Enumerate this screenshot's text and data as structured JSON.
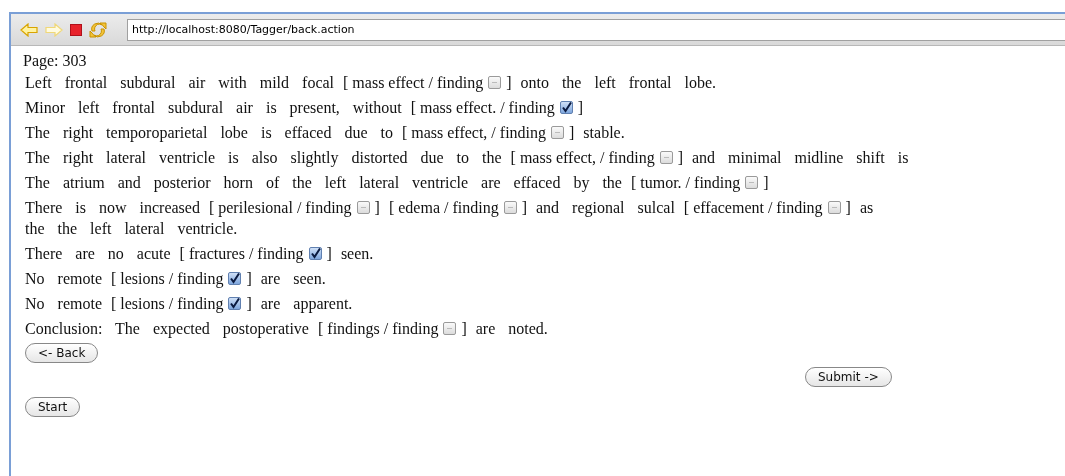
{
  "toolbar": {
    "url": "http://localhost:8080/Tagger/back.action"
  },
  "page_label": "Page: 303",
  "sentences": [
    {
      "parts": [
        {
          "kind": "text",
          "text": "Left frontal subdural air with mild focal"
        },
        {
          "kind": "tag",
          "text": "[ mass effect / finding",
          "checked": false,
          "close": "]"
        },
        {
          "kind": "text",
          "text": "onto the left frontal lobe."
        }
      ]
    },
    {
      "parts": [
        {
          "kind": "text",
          "text": "Minor left frontal subdural air is present, without"
        },
        {
          "kind": "tag",
          "text": "[ mass effect. / finding",
          "checked": true,
          "close": "]"
        }
      ]
    },
    {
      "parts": [
        {
          "kind": "text",
          "text": "The right temporoparietal lobe is effaced due to"
        },
        {
          "kind": "tag",
          "text": "[ mass effect, / finding",
          "checked": false,
          "close": "]"
        },
        {
          "kind": "text",
          "text": "stable."
        }
      ]
    },
    {
      "parts": [
        {
          "kind": "text",
          "text": "The right lateral ventricle is also slightly distorted due to the"
        },
        {
          "kind": "tag",
          "text": "[ mass effect, / finding",
          "checked": false,
          "close": "]"
        },
        {
          "kind": "text",
          "text": "and minimal midline shift is"
        }
      ]
    },
    {
      "parts": [
        {
          "kind": "text",
          "text": "The atrium and posterior horn of the left lateral ventricle are effaced by the"
        },
        {
          "kind": "tag",
          "text": "[ tumor. / finding",
          "checked": false,
          "close": "]"
        }
      ]
    },
    {
      "parts": [
        {
          "kind": "text",
          "text": "There is now increased"
        },
        {
          "kind": "tag",
          "text": "[ perilesional / finding",
          "checked": false,
          "close": "]"
        },
        {
          "kind": "tag",
          "text": "[ edema / finding",
          "checked": false,
          "close": "]"
        },
        {
          "kind": "text",
          "text": "and regional sulcal"
        },
        {
          "kind": "tag",
          "text": "[ effacement / finding",
          "checked": false,
          "close": "]"
        },
        {
          "kind": "text",
          "text": "as"
        },
        {
          "kind": "break"
        },
        {
          "kind": "text",
          "text": "the the left lateral ventricle."
        }
      ]
    },
    {
      "parts": [
        {
          "kind": "text",
          "text": "There are no acute"
        },
        {
          "kind": "tag",
          "text": "[ fractures / finding",
          "checked": true,
          "close": "]"
        },
        {
          "kind": "text",
          "text": "seen."
        }
      ]
    },
    {
      "parts": [
        {
          "kind": "text",
          "text": "No remote"
        },
        {
          "kind": "tag",
          "text": "[ lesions / finding",
          "checked": true,
          "close": "]"
        },
        {
          "kind": "text",
          "text": "are seen."
        }
      ]
    },
    {
      "parts": [
        {
          "kind": "text",
          "text": "No remote"
        },
        {
          "kind": "tag",
          "text": "[ lesions / finding",
          "checked": true,
          "close": "]"
        },
        {
          "kind": "text",
          "text": "are apparent."
        }
      ]
    },
    {
      "parts": [
        {
          "kind": "text",
          "text": "Conclusion: The expected postoperative"
        },
        {
          "kind": "tag",
          "text": "[ findings / finding",
          "checked": false,
          "close": "]"
        },
        {
          "kind": "text",
          "text": "are noted."
        }
      ]
    }
  ],
  "buttons": {
    "back": "<- Back",
    "submit": "Submit ->",
    "start": "Start"
  }
}
